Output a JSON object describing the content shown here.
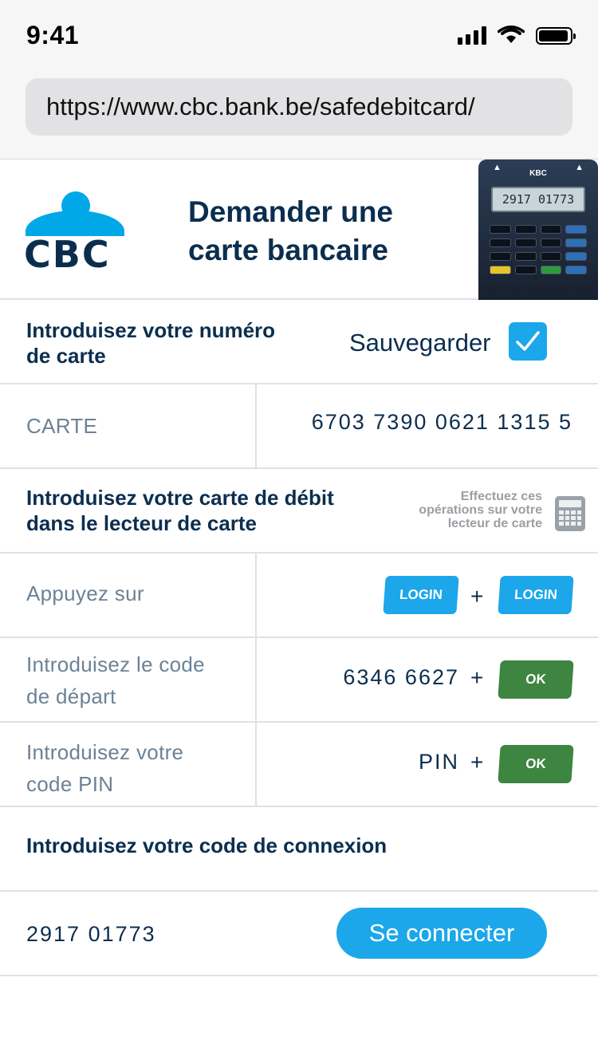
{
  "status_bar": {
    "time": "9:41"
  },
  "browser": {
    "url": "https://www.cbc.bank.be/safedebitcard/"
  },
  "header": {
    "logo_text": "CBC",
    "title_line1": "Demander une",
    "title_line2": "carte bancaire",
    "reader_brand": "KBC",
    "reader_screen": "2917 01773"
  },
  "card_number_section": {
    "label_line1": "Introduisez votre numéro",
    "label_line2": "de carte",
    "save_label": "Sauvegarder",
    "save_checked": true
  },
  "card_row": {
    "label": "CARTE",
    "value": "6703 7390 0621 1315 5"
  },
  "insert_section": {
    "label_line1": "Introduisez votre carte de débit",
    "label_line2": "dans le lecteur de carte",
    "note_line1": "Effectuez ces",
    "note_line2": "opérations sur votre",
    "note_line3": "lecteur de carte"
  },
  "steps": [
    {
      "label_line1": "Appuyez sur",
      "label_line2": "",
      "value": "",
      "keys": [
        "LOGIN",
        "LOGIN"
      ]
    },
    {
      "label_line1": "Introduisez le code",
      "label_line2": "de départ",
      "value": "6346 6627",
      "keys": [
        "OK"
      ]
    },
    {
      "label_line1": "Introduisez votre",
      "label_line2": "code PIN",
      "value": "PIN",
      "keys": [
        "OK"
      ]
    }
  ],
  "plus_sign": "+",
  "connection_section": {
    "label": "Introduisez votre code de connexion"
  },
  "connection_row": {
    "code": "2917 01773",
    "button_label": "Se connecter"
  },
  "colors": {
    "accent": "#1ca7ea",
    "ok_green": "#3d8540",
    "navy": "#0b2e4f",
    "muted": "#6c8296"
  }
}
